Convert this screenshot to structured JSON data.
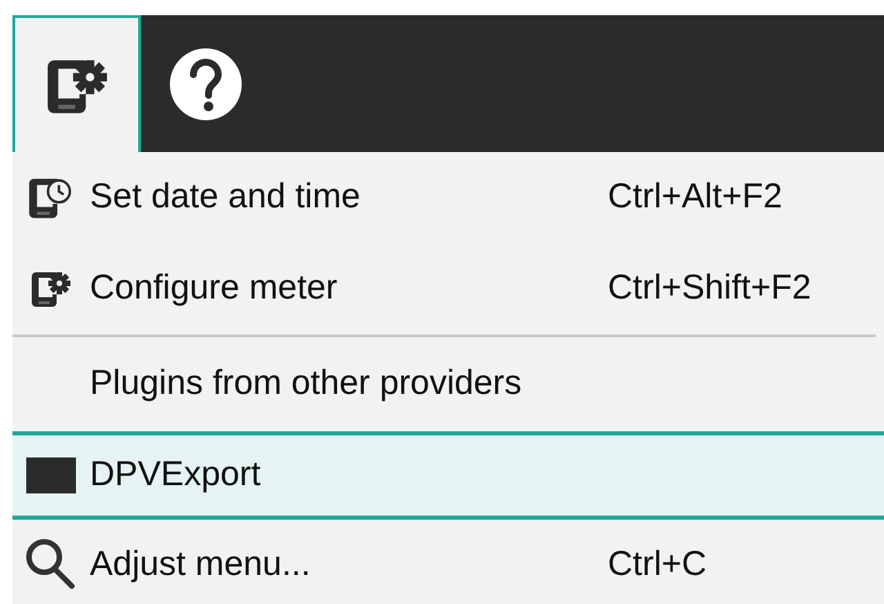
{
  "toolbar": {
    "tabs": [
      {
        "selected": true
      },
      {
        "selected": false
      }
    ]
  },
  "menu": [
    {
      "kind": "item",
      "label": "Set date and time",
      "shortcut": "Ctrl+Alt+F2",
      "selected": false
    },
    {
      "kind": "item",
      "label": "Configure meter",
      "shortcut": "Ctrl+Shift+F2",
      "selected": false
    },
    {
      "kind": "separator"
    },
    {
      "kind": "header",
      "label": "Plugins from other providers"
    },
    {
      "kind": "item",
      "label": "DPVExport",
      "selected": true
    },
    {
      "kind": "item",
      "label": "Adjust menu...",
      "shortcut": "Ctrl+C",
      "selected": false
    }
  ]
}
